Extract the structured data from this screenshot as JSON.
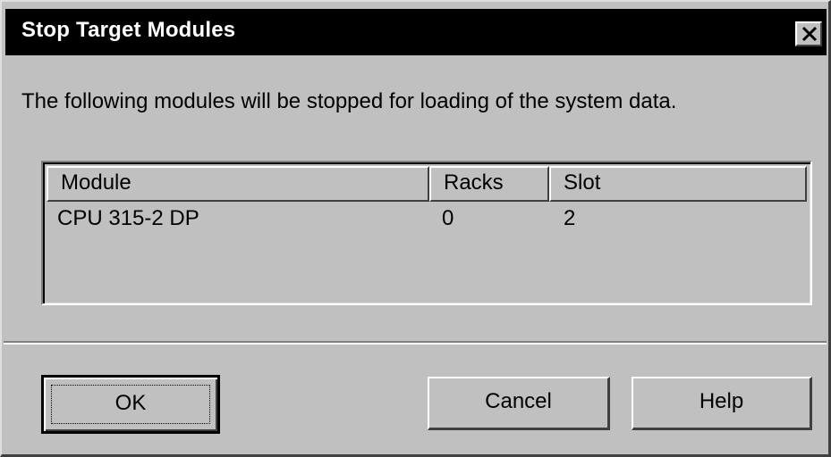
{
  "dialog": {
    "title": "Stop Target Modules",
    "message": "The following modules will be stopped for loading of the system data."
  },
  "list": {
    "columns": [
      "Module",
      "Racks",
      "Slot"
    ],
    "rows": [
      {
        "module": "CPU 315-2 DP",
        "racks": "0",
        "slot": "2"
      }
    ]
  },
  "buttons": {
    "ok": "OK",
    "cancel": "Cancel",
    "help": "Help"
  },
  "colors": {
    "title_bar": "#000000",
    "title_text": "#ffffff",
    "face": "#c0c0c0"
  }
}
